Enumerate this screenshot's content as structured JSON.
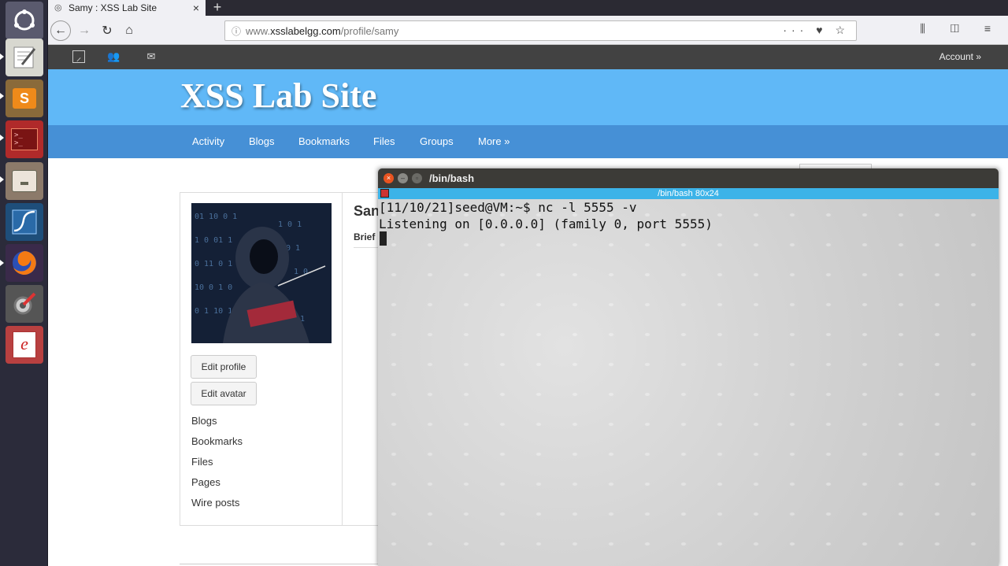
{
  "browser": {
    "tab_title": "Samy : XSS Lab Site",
    "tab_close": "×",
    "new_tab": "+",
    "url_scheme_icon": "info-icon",
    "url_prefix": "www.",
    "url_host": "xsslabelgg.com",
    "url_path": "/profile/samy",
    "url_actions": "··· ♥ ☆",
    "toolbar_right": "⫼ ◫ ≡"
  },
  "elgg": {
    "account_label": "Account »",
    "site_title": "XSS Lab Site",
    "menu": [
      "Activity",
      "Blogs",
      "Bookmarks",
      "Files",
      "Groups",
      "More »"
    ],
    "profile": {
      "name_fragment": "San",
      "brief_fragment": "Brief",
      "edit_profile": "Edit profile",
      "edit_avatar": "Edit avatar",
      "links": [
        "Blogs",
        "Bookmarks",
        "Files",
        "Pages",
        "Wire posts"
      ]
    }
  },
  "terminal": {
    "window_title": "/bin/bash",
    "tab_title": "/bin/bash 80x24",
    "lines": [
      "[11/10/21]seed@VM:~$ nc -l 5555 -v",
      "Listening on [0.0.0.0] (family 0, port 5555)"
    ]
  },
  "launcher": {
    "apps": [
      "ubuntu-dash-icon",
      "text-editor-icon",
      "sublime-text-icon",
      "terminal-icon",
      "file-manager-icon",
      "wireshark-icon",
      "firefox-icon",
      "system-settings-icon",
      "document-viewer-icon"
    ]
  },
  "colors": {
    "elgg_header": "#60b8f7",
    "elgg_menu": "#4690d6",
    "elgg_topbar": "#424242",
    "terminal_tab": "#3cb3e8"
  }
}
